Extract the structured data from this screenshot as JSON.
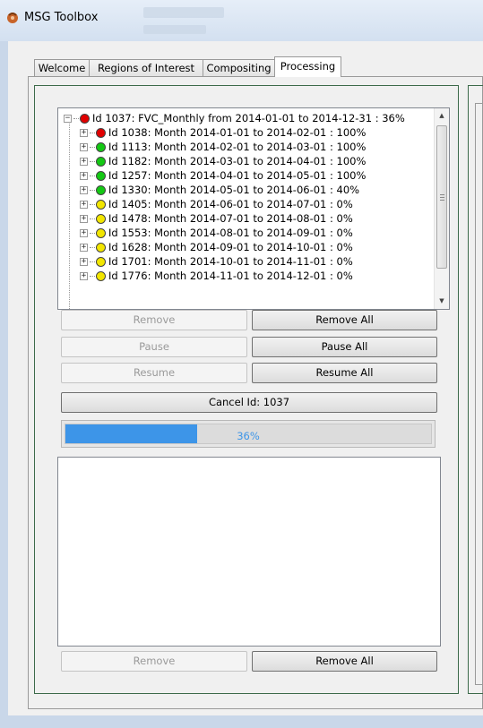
{
  "window": {
    "title": "MSG Toolbox"
  },
  "tabs": [
    {
      "label": "Welcome"
    },
    {
      "label": "Regions of Interest"
    },
    {
      "label": "Compositing"
    },
    {
      "label": "Processing"
    }
  ],
  "tree": {
    "root": {
      "label": "Id 1037: FVC_Monthly from 2014-01-01 to 2014-12-31 : 36%",
      "status": "red"
    },
    "children": [
      {
        "label": "Id 1038: Month 2014-01-01 to 2014-02-01 : 100%",
        "status": "red"
      },
      {
        "label": "Id 1113: Month 2014-02-01 to 2014-03-01 : 100%",
        "status": "green"
      },
      {
        "label": "Id 1182: Month 2014-03-01 to 2014-04-01 : 100%",
        "status": "green"
      },
      {
        "label": "Id 1257: Month 2014-04-01 to 2014-05-01 : 100%",
        "status": "green"
      },
      {
        "label": "Id 1330: Month 2014-05-01 to 2014-06-01 : 40%",
        "status": "green"
      },
      {
        "label": "Id 1405: Month 2014-06-01 to 2014-07-01 : 0%",
        "status": "yellow"
      },
      {
        "label": "Id 1478: Month 2014-07-01 to 2014-08-01 : 0%",
        "status": "yellow"
      },
      {
        "label": "Id 1553: Month 2014-08-01 to 2014-09-01 : 0%",
        "status": "yellow"
      },
      {
        "label": "Id 1628: Month 2014-09-01 to 2014-10-01 : 0%",
        "status": "yellow"
      },
      {
        "label": "Id 1701: Month 2014-10-01 to 2014-11-01 : 0%",
        "status": "yellow"
      },
      {
        "label": "Id 1776: Month 2014-11-01 to 2014-12-01 : 0%",
        "status": "yellow"
      }
    ]
  },
  "colors": {
    "red": "#e00000",
    "green": "#14c814",
    "yellow": "#f2e600",
    "accent": "#3d95e8"
  },
  "buttons": {
    "remove": "Remove",
    "remove_all": "Remove All",
    "pause": "Pause",
    "pause_all": "Pause All",
    "resume": "Resume",
    "resume_all": "Resume All",
    "cancel": "Cancel Id: 1037",
    "log_remove": "Remove",
    "log_remove_all": "Remove All"
  },
  "progress": {
    "value": 0.36,
    "label": "36%"
  }
}
